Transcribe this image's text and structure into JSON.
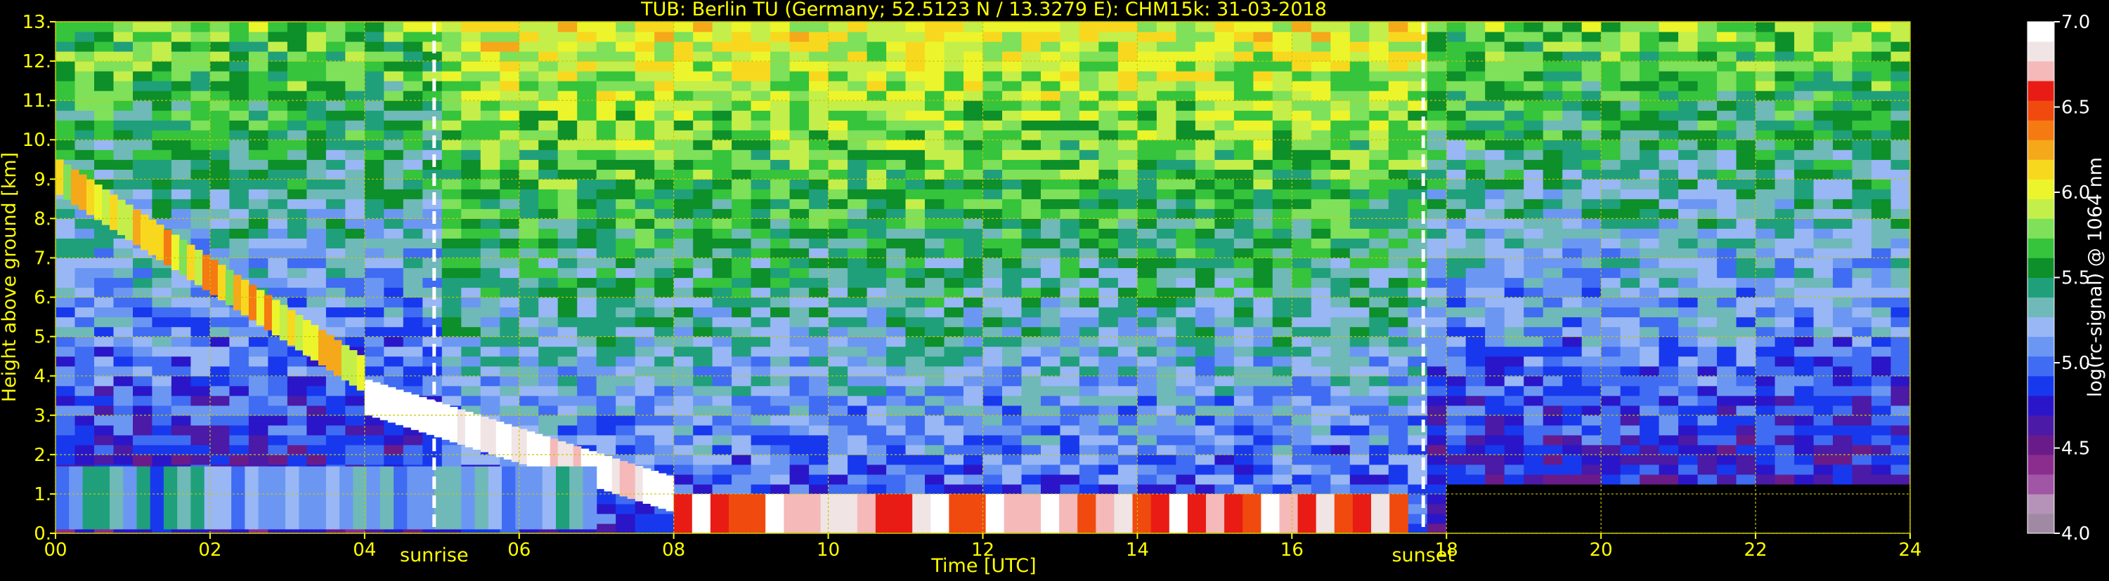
{
  "chart_data": {
    "type": "heatmap",
    "title": "TUB: Berlin TU (Germany; 52.5123 N / 13.3279 E):    CHM15k: 31-03-2018",
    "xlabel": "Time [UTC]",
    "ylabel": "Height above ground [km]",
    "xlim": [
      0,
      24
    ],
    "ylim": [
      0,
      13
    ],
    "x_ticks": [
      0,
      2,
      4,
      6,
      8,
      10,
      12,
      14,
      16,
      18,
      20,
      22,
      24
    ],
    "x_tick_labels": [
      "00",
      "02",
      "04",
      "06",
      "08",
      "10",
      "12",
      "14",
      "16",
      "18",
      "20",
      "22",
      "24"
    ],
    "y_ticks": [
      0,
      1,
      2,
      3,
      4,
      5,
      6,
      7,
      8,
      9,
      10,
      11,
      12,
      13
    ],
    "y_tick_labels": [
      "0.",
      "1.",
      "2.",
      "3.",
      "4.",
      "5.",
      "6.",
      "7.",
      "8.",
      "9.",
      "10.",
      "11.",
      "12.",
      "13."
    ],
    "grid": true,
    "events": [
      {
        "label": "sunrise",
        "time": 4.9
      },
      {
        "label": "sunset",
        "time": 17.7
      }
    ],
    "colorbar": {
      "label": "log(rc-signal) @ 1064 nm",
      "range": [
        4.0,
        7.0
      ],
      "ticks": [
        4.0,
        4.5,
        5.0,
        5.5,
        6.0,
        6.5,
        7.0
      ],
      "tick_labels": [
        "4.0",
        "4.5",
        "5.0",
        "5.5",
        "6.0",
        "6.5",
        "7.0"
      ],
      "colors": [
        "#a08aa3",
        "#b593b8",
        "#a055a5",
        "#8a2d8f",
        "#6a1b8a",
        "#4b1aa6",
        "#2a16c8",
        "#1838ee",
        "#3f6cf2",
        "#6b97f3",
        "#98b7f4",
        "#6fb9b8",
        "#1fa07a",
        "#0d8f2a",
        "#35c43c",
        "#7fe05a",
        "#c4ef4a",
        "#ecf52b",
        "#f8d81f",
        "#f5a81a",
        "#f57a12",
        "#f04a0f",
        "#e81c14",
        "#f5b9b9",
        "#f0e4e4",
        "#ffffff"
      ]
    },
    "features": [
      {
        "name": "cirrus",
        "t_start": 0.0,
        "t_end": 4.0,
        "h_top": 9.5,
        "h_bottom": 3.8,
        "level": 6.1
      },
      {
        "name": "descending cloud",
        "t_start": 4.0,
        "t_end": 8.0,
        "h_top": 3.9,
        "h_bottom": 0.8,
        "level": 7.0
      },
      {
        "name": "boundary layer",
        "t_start": 0.0,
        "t_end": 7.0,
        "h_top": 1.7,
        "h_bottom": 0.1,
        "level": 5.2
      },
      {
        "name": "low cloud",
        "t_start": 8.0,
        "t_end": 17.5,
        "h_top": 1.0,
        "h_bottom": 0.0,
        "level": 6.7
      }
    ],
    "colors": {
      "text": "#ffff00",
      "grid": "#c8c800",
      "event_line": "#ffffff",
      "background": "#000000"
    }
  }
}
